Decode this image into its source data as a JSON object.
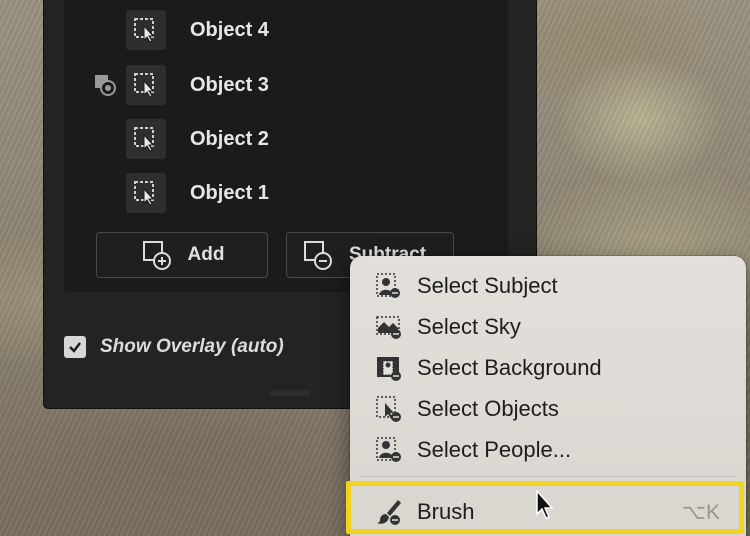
{
  "masks_panel": {
    "items": [
      {
        "label": "Object 4",
        "active": false
      },
      {
        "label": "Object 3",
        "active": true
      },
      {
        "label": "Object 2",
        "active": false
      },
      {
        "label": "Object 1",
        "active": false
      }
    ],
    "add_button": "Add",
    "subtract_button": "Subtract",
    "show_overlay": {
      "label": "Show Overlay (auto)",
      "checked": true
    }
  },
  "context_menu": {
    "items": [
      {
        "label": "Select Subject",
        "icon": "select-subject-icon"
      },
      {
        "label": "Select Sky",
        "icon": "select-sky-icon"
      },
      {
        "label": "Select Background",
        "icon": "select-background-icon"
      },
      {
        "label": "Select Objects",
        "icon": "select-objects-icon"
      },
      {
        "label": "Select People...",
        "icon": "select-people-icon"
      }
    ],
    "brush": {
      "label": "Brush",
      "shortcut": "⌥K",
      "icon": "brush-icon",
      "highlighted": true
    }
  },
  "colors": {
    "panel_bg": "#232323",
    "menu_bg": "#e0dcd7",
    "highlight": "#f2d321"
  }
}
